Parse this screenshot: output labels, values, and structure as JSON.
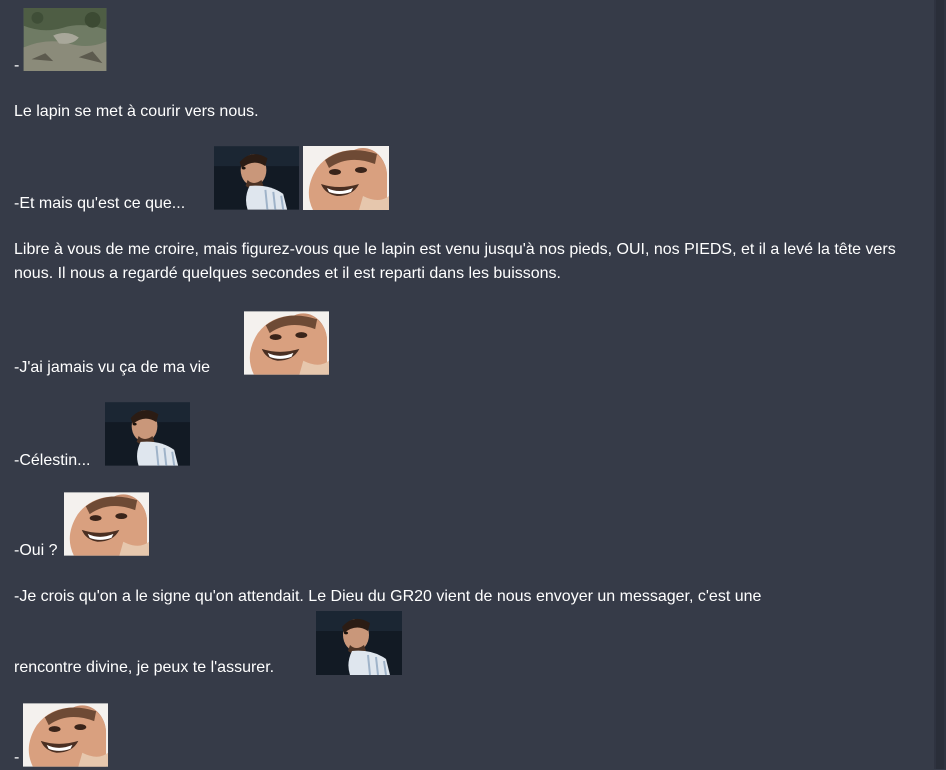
{
  "post": {
    "lines": [
      "-",
      "Le lapin se met à courir vers nous.",
      "-Et mais qu'est ce que...",
      "Libre à vous de me croire, mais figurez-vous que le lapin est venu jusqu'à nos pieds, OUI, nos PIEDS, et il a levé la tête vers nous. Il nous a regardé quelques secondes et il est reparti dans les buissons.",
      "-J'ai jamais vu ça de ma vie",
      "-Célestin...",
      "-Oui ?",
      "-Je crois qu'on a le signe qu'on attendait. Le Dieu du GR20 vient de nous envoyer un messager, c'est une",
      "rencontre divine, je peux te l'assurer.",
      "-"
    ]
  },
  "stickers": {
    "landscape": "landscape-photo",
    "soccer": "soccer-player-sticker",
    "laughing": "laughing-man-sticker"
  },
  "colors": {
    "background": "#363b48",
    "text": "#ffffff"
  }
}
